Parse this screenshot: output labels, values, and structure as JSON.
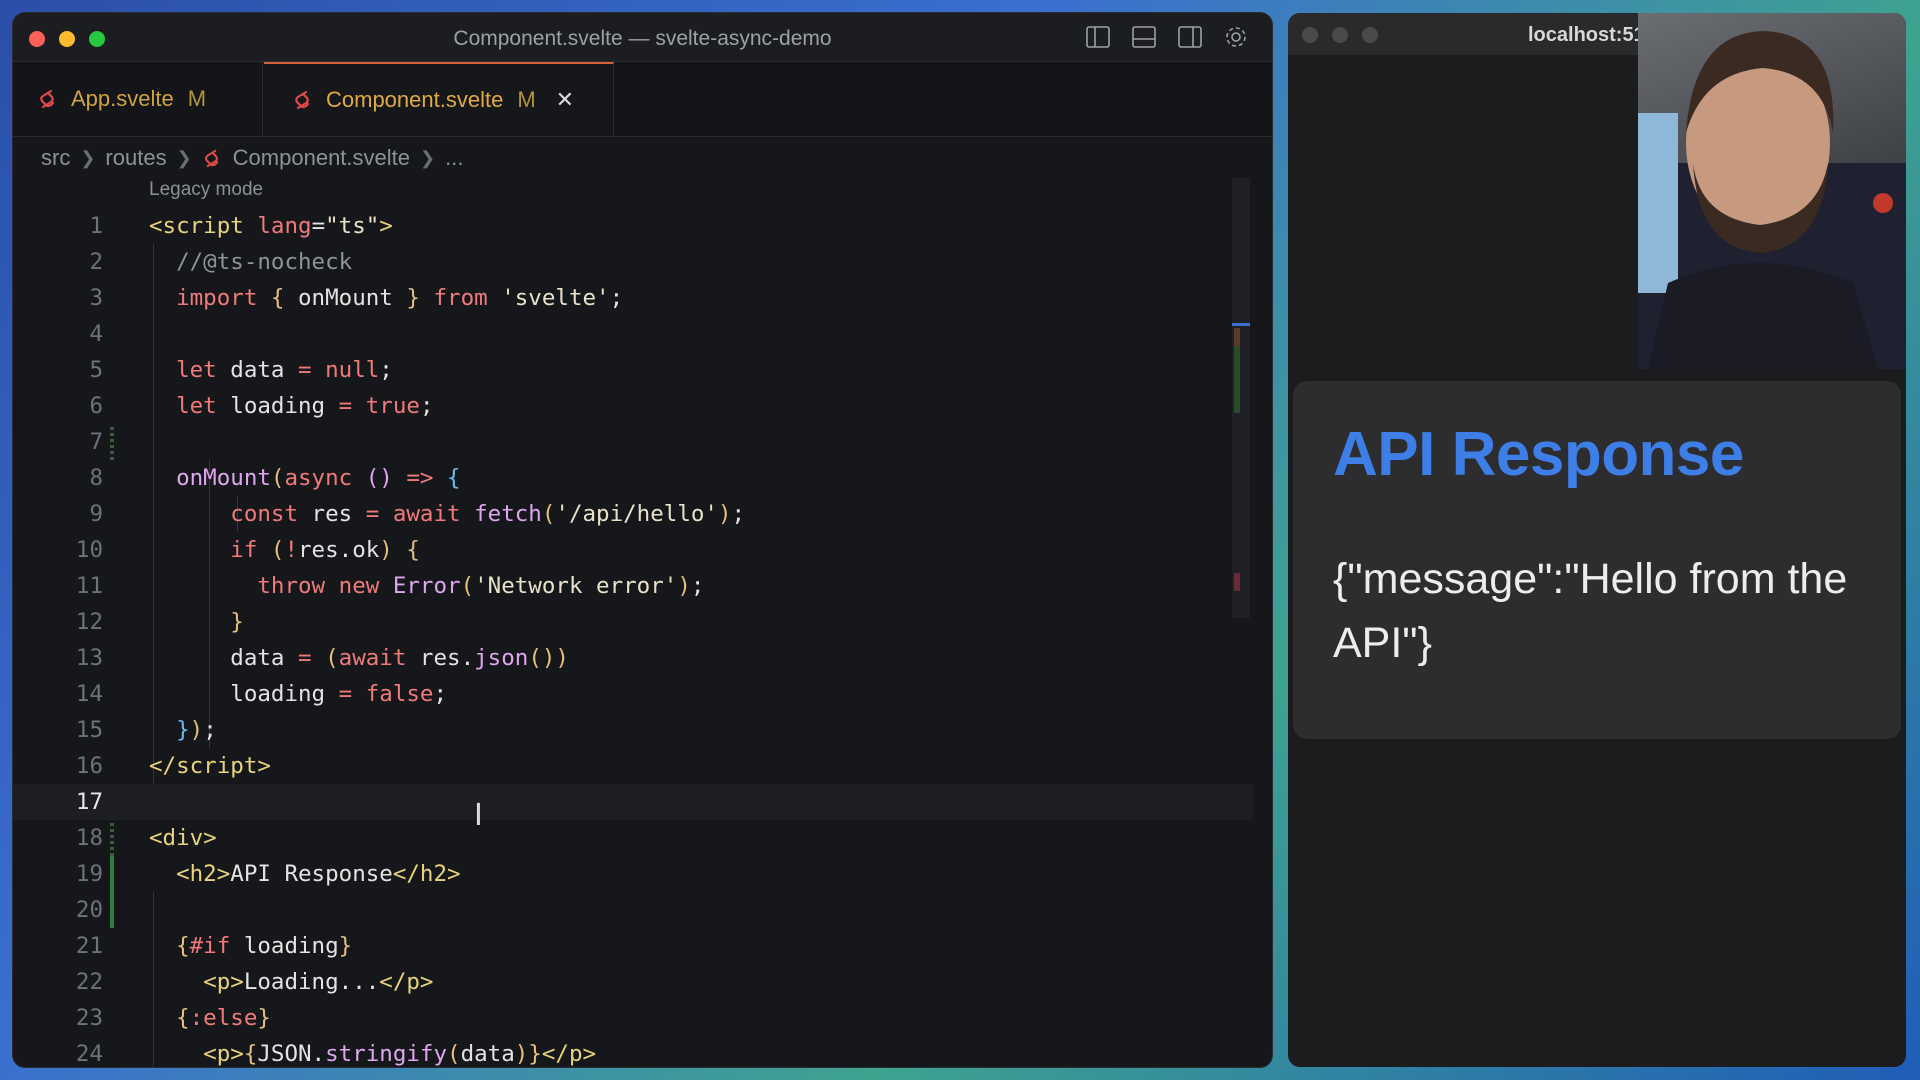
{
  "editor": {
    "window_title": "Component.svelte — svelte-async-demo",
    "tabs": [
      {
        "label": "App.svelte",
        "badge": "M"
      },
      {
        "label": "Component.svelte",
        "badge": "M",
        "close": "✕"
      }
    ],
    "breadcrumb": {
      "part1": "src",
      "part2": "routes",
      "part3": "Component.svelte",
      "part4": "..."
    },
    "codelens": "Legacy mode",
    "line_numbers": [
      "1",
      "2",
      "3",
      "4",
      "5",
      "6",
      "7",
      "8",
      "9",
      "10",
      "11",
      "12",
      "13",
      "14",
      "15",
      "16",
      "17",
      "18",
      "19",
      "20",
      "21",
      "22",
      "23",
      "24"
    ]
  },
  "browser": {
    "url": "localhost:51",
    "heading": "API Response",
    "body": "{\"message\":\"Hello from the API\"}"
  },
  "colors": {
    "accent_tab": "#d4603e",
    "heading_blue": "#3d7fe6",
    "svelte_icon": "#e04a4a"
  }
}
